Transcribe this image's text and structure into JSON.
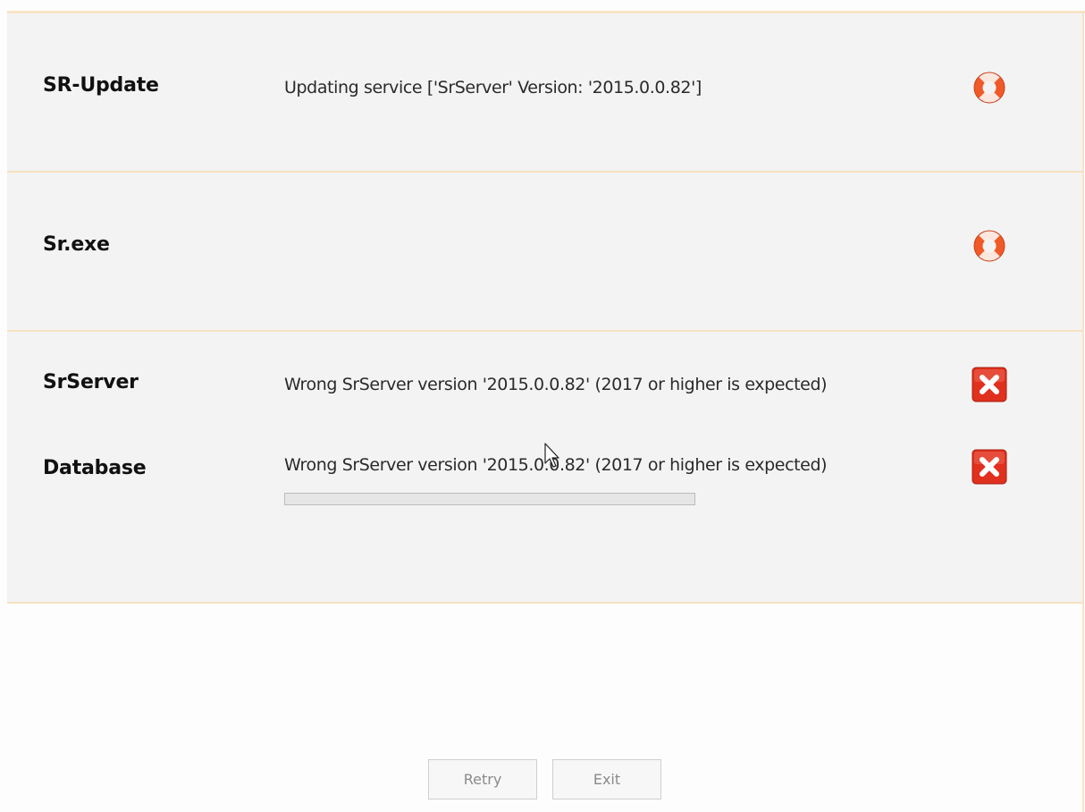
{
  "rows": [
    {
      "title": "SR-Update",
      "message": "Updating service ['SrServer' Version: '2015.0.0.82']",
      "icon": "lifebuoy-icon"
    },
    {
      "title": "Sr.exe",
      "message": "",
      "icon": "lifebuoy-icon"
    },
    {
      "title": "SrServer",
      "message": "Wrong SrServer version '2015.0.0.82' (2017 or higher is expected)",
      "icon": "error-icon"
    },
    {
      "title": "Database",
      "message": "Wrong SrServer version '2015.0.0.82' (2017 or higher is expected)",
      "icon": "error-icon",
      "progress": 0
    }
  ],
  "buttons": {
    "retry_label": "Retry",
    "exit_label": "Exit"
  },
  "colors": {
    "panel_background": "#f3f3f3",
    "panel_border": "#f6e2c0",
    "error_red": "#e0301e",
    "lifebuoy_orange": "#f05a28"
  }
}
